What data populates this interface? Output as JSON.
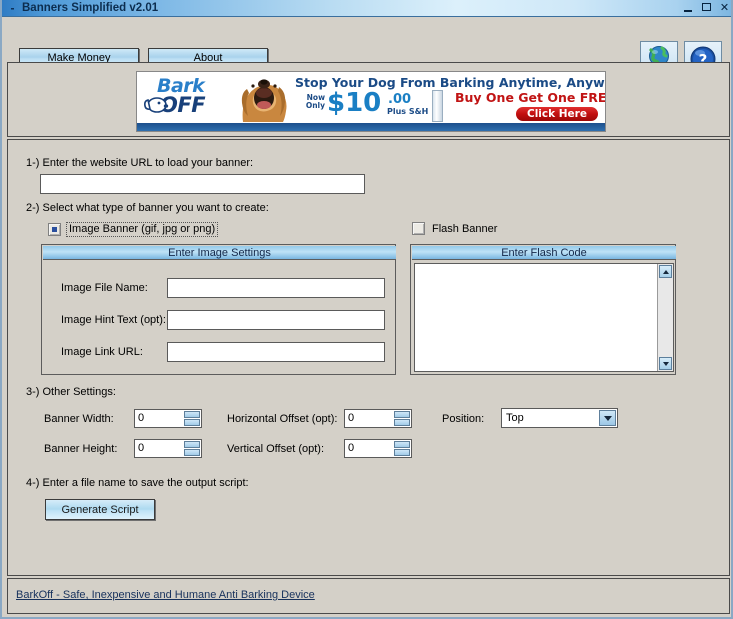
{
  "window": {
    "title": "Banners Simplified v2.01",
    "system_icon": "dash-icon",
    "minimize_label": "Minimize",
    "maximize_label": "Maximize",
    "close_label": "✕"
  },
  "toolbar": {
    "make_money_label": "Make Money",
    "about_label": "About",
    "globe_icon": "globe-icon",
    "help_icon": "help-question-icon"
  },
  "ad": {
    "logo_line1": "Bark",
    "logo_line2": "OFF",
    "headline": "Stop Your Dog From Barking Anytime, Anywhere!",
    "now_only": "Now\nOnly",
    "price": "$10",
    "cents": ".00",
    "shipping": "Plus S&H",
    "bogo": "Buy One Get One FREE!",
    "click_here": "Click Here"
  },
  "form": {
    "step1_label": "1-) Enter the website URL to load your banner:",
    "url_value": "",
    "url_placeholder": "",
    "step2_label": "2-) Select what type of banner you want to create:",
    "image_banner_label": "Image Banner (gif, jpg or png)",
    "flash_banner_label": "Flash Banner",
    "image_group_title": "Enter Image Settings",
    "flash_group_title": "Enter Flash Code",
    "image_file_name_label": "Image File Name:",
    "image_file_name_value": "",
    "image_hint_label": "Image Hint Text (opt):",
    "image_hint_value": "",
    "image_link_label": "Image Link URL:",
    "image_link_value": "",
    "flash_code_value": "",
    "step3_label": "3-) Other Settings:",
    "banner_width_label": "Banner Width:",
    "banner_width_value": "0",
    "banner_height_label": "Banner Height:",
    "banner_height_value": "0",
    "horizontal_offset_label": "Horizontal Offset (opt):",
    "horizontal_offset_value": "0",
    "vertical_offset_label": "Vertical Offset (opt):",
    "vertical_offset_value": "0",
    "position_label": "Position:",
    "position_value": "Top",
    "step4_label": "4-) Enter a file name to save the output script:",
    "generate_label": "Generate Script"
  },
  "status": {
    "link_text": "BarkOff - Safe, Inexpensive and Humane Anti Barking Device"
  },
  "colors": {
    "title_blue": "#2f7cc4",
    "face": "#d4d0c8",
    "accent_blue": "#1a7fc4",
    "red": "#c11414",
    "link": "#17315c"
  }
}
